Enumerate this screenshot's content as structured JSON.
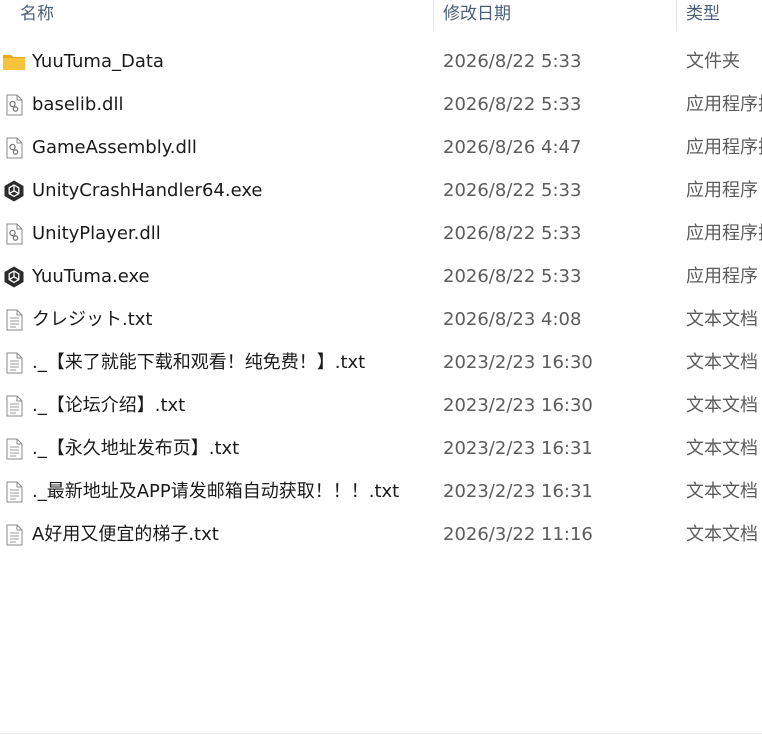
{
  "columns": {
    "name": "名称",
    "date": "修改日期",
    "type": "类型"
  },
  "files": [
    {
      "name": "YuuTuma_Data",
      "date": "2026/8/22 5:33",
      "type": "文件夹",
      "icon": "folder-icon"
    },
    {
      "name": "baselib.dll",
      "date": "2026/8/22 5:33",
      "type": "应用程序扩展",
      "icon": "dll-file-icon"
    },
    {
      "name": "GameAssembly.dll",
      "date": "2026/8/26 4:47",
      "type": "应用程序扩展",
      "icon": "dll-file-icon"
    },
    {
      "name": "UnityCrashHandler64.exe",
      "date": "2026/8/22 5:33",
      "type": "应用程序",
      "icon": "unity-app-icon"
    },
    {
      "name": "UnityPlayer.dll",
      "date": "2026/8/22 5:33",
      "type": "应用程序扩展",
      "icon": "dll-file-icon"
    },
    {
      "name": "YuuTuma.exe",
      "date": "2026/8/22 5:33",
      "type": "应用程序",
      "icon": "unity-app-icon"
    },
    {
      "name": "クレジット.txt",
      "date": "2026/8/23 4:08",
      "type": "文本文档",
      "icon": "text-file-icon"
    },
    {
      "name": "._【来了就能下载和观看！纯免费！】.txt",
      "date": "2023/2/23 16:30",
      "type": "文本文档",
      "icon": "text-file-icon"
    },
    {
      "name": "._【论坛介绍】.txt",
      "date": "2023/2/23 16:30",
      "type": "文本文档",
      "icon": "text-file-icon"
    },
    {
      "name": "._【永久地址发布页】.txt",
      "date": "2023/2/23 16:31",
      "type": "文本文档",
      "icon": "text-file-icon"
    },
    {
      "name": "._最新地址及APP请发邮箱自动获取！！！.txt",
      "date": "2023/2/23 16:31",
      "type": "文本文档",
      "icon": "text-file-icon"
    },
    {
      "name": "A好用又便宜的梯子.txt",
      "date": "2026/3/22 11:16",
      "type": "文本文档",
      "icon": "text-file-icon"
    }
  ],
  "colors": {
    "folder": "#f8c33c",
    "folder_dark": "#e6a718",
    "header_text": "#4c607a",
    "secondary_text": "#5c5c5c"
  }
}
